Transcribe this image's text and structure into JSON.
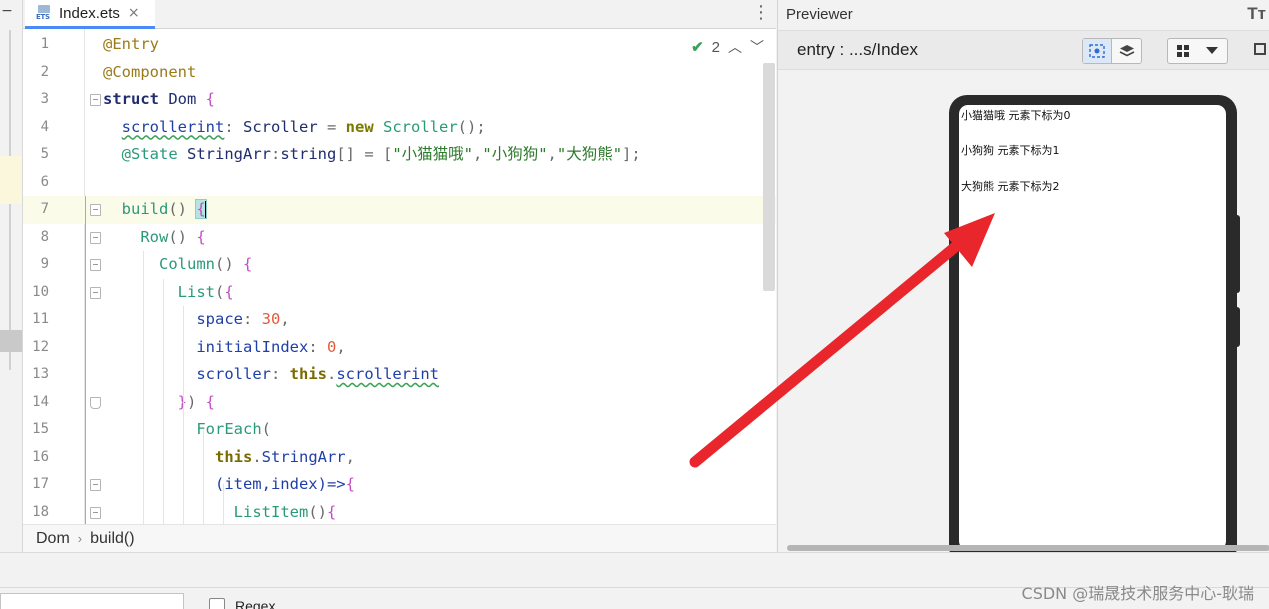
{
  "tab": {
    "label": "Index.ets",
    "icon_text": "ETS",
    "close": "×"
  },
  "editor": {
    "inspection_count": "2",
    "lines": [
      {
        "n": "1",
        "segments": [
          {
            "t": "@Entry",
            "c": "k-anno"
          }
        ]
      },
      {
        "n": "2",
        "segments": [
          {
            "t": "@Component",
            "c": "k-anno"
          }
        ]
      },
      {
        "n": "3",
        "segments": [
          {
            "t": "struct",
            "c": "k-kw"
          },
          {
            "t": " Dom ",
            "c": "k-id"
          },
          {
            "t": "{",
            "c": "k-br"
          }
        ]
      },
      {
        "n": "4",
        "segments": [
          {
            "t": "  "
          },
          {
            "t": "scrollerint",
            "c": "k-prop squig"
          },
          {
            "t": ": ",
            "c": "k-pun"
          },
          {
            "t": "Scroller",
            "c": "k-id"
          },
          {
            "t": " = ",
            "c": "k-pun"
          },
          {
            "t": "new",
            "c": "k-kw2"
          },
          {
            "t": " "
          },
          {
            "t": "Scroller",
            "c": "k-fn"
          },
          {
            "t": "();",
            "c": "k-pun"
          }
        ]
      },
      {
        "n": "5",
        "segments": [
          {
            "t": "  "
          },
          {
            "t": "@State",
            "c": "k-fn"
          },
          {
            "t": " StringArr",
            "c": "k-id"
          },
          {
            "t": ":",
            "c": "k-pun"
          },
          {
            "t": "string",
            "c": "k-id"
          },
          {
            "t": "[] = [",
            "c": "k-pun"
          },
          {
            "t": "\"小猫猫哦\"",
            "c": "k-str"
          },
          {
            "t": ",",
            "c": "k-pun"
          },
          {
            "t": "\"小狗狗\"",
            "c": "k-str"
          },
          {
            "t": ",",
            "c": "k-pun"
          },
          {
            "t": "\"大狗熊\"",
            "c": "k-str"
          },
          {
            "t": "];",
            "c": "k-pun"
          }
        ]
      },
      {
        "n": "6",
        "segments": []
      },
      {
        "n": "7",
        "segments": [
          {
            "t": "  "
          },
          {
            "t": "build",
            "c": "k-fn"
          },
          {
            "t": "() ",
            "c": "k-pun"
          },
          {
            "t": "{",
            "c": "k-br cursor-brace"
          }
        ]
      },
      {
        "n": "8",
        "segments": [
          {
            "t": "    "
          },
          {
            "t": "Row",
            "c": "k-fn"
          },
          {
            "t": "() ",
            "c": "k-pun"
          },
          {
            "t": "{",
            "c": "k-br"
          }
        ]
      },
      {
        "n": "9",
        "segments": [
          {
            "t": "      "
          },
          {
            "t": "Column",
            "c": "k-fn"
          },
          {
            "t": "() ",
            "c": "k-pun"
          },
          {
            "t": "{",
            "c": "k-br"
          }
        ]
      },
      {
        "n": "10",
        "segments": [
          {
            "t": "        "
          },
          {
            "t": "List",
            "c": "k-fn"
          },
          {
            "t": "(",
            "c": "k-pun"
          },
          {
            "t": "{",
            "c": "k-br"
          }
        ]
      },
      {
        "n": "11",
        "segments": [
          {
            "t": "          "
          },
          {
            "t": "space",
            "c": "k-prop"
          },
          {
            "t": ": ",
            "c": "k-pun"
          },
          {
            "t": "30",
            "c": "k-num"
          },
          {
            "t": ",",
            "c": "k-pun"
          }
        ]
      },
      {
        "n": "12",
        "segments": [
          {
            "t": "          "
          },
          {
            "t": "initialIndex",
            "c": "k-prop"
          },
          {
            "t": ": ",
            "c": "k-pun"
          },
          {
            "t": "0",
            "c": "k-num"
          },
          {
            "t": ",",
            "c": "k-pun"
          }
        ]
      },
      {
        "n": "13",
        "segments": [
          {
            "t": "          "
          },
          {
            "t": "scroller",
            "c": "k-prop"
          },
          {
            "t": ": ",
            "c": "k-pun"
          },
          {
            "t": "this",
            "c": "k-th"
          },
          {
            "t": ".",
            "c": "k-pun"
          },
          {
            "t": "scrollerint",
            "c": "k-prop squig"
          }
        ]
      },
      {
        "n": "14",
        "segments": [
          {
            "t": "        "
          },
          {
            "t": "}",
            "c": "k-br"
          },
          {
            "t": ") ",
            "c": "k-pun"
          },
          {
            "t": "{",
            "c": "k-br"
          }
        ]
      },
      {
        "n": "15",
        "segments": [
          {
            "t": "          "
          },
          {
            "t": "ForEach",
            "c": "k-fn"
          },
          {
            "t": "(",
            "c": "k-pun"
          }
        ]
      },
      {
        "n": "16",
        "segments": [
          {
            "t": "            "
          },
          {
            "t": "this",
            "c": "k-th"
          },
          {
            "t": ".",
            "c": "k-pun"
          },
          {
            "t": "StringArr",
            "c": "k-prop"
          },
          {
            "t": ",",
            "c": "k-pun"
          }
        ]
      },
      {
        "n": "17",
        "segments": [
          {
            "t": "            "
          },
          {
            "t": "(item,index)=>",
            "c": "k-prop"
          },
          {
            "t": "{",
            "c": "k-br"
          }
        ]
      },
      {
        "n": "18",
        "segments": [
          {
            "t": "              "
          },
          {
            "t": "ListItem",
            "c": "k-fn"
          },
          {
            "t": "()",
            "c": "k-pun"
          },
          {
            "t": "{",
            "c": "k-br"
          }
        ]
      }
    ]
  },
  "breadcrumb": {
    "items": [
      "Dom",
      "build()"
    ],
    "separator": "›"
  },
  "previewer": {
    "title": "Previewer",
    "title_icon": "Tт",
    "path": "entry : ...s/Index",
    "list_items": [
      "小猫猫哦 元素下标为0",
      "小狗狗 元素下标为1",
      "大狗熊 元素下标为2"
    ]
  },
  "bottom": {
    "regex_label": "Regex"
  },
  "watermark": "CSDN @瑞晟技术服务中心-耿瑞",
  "colors": {
    "arrow": "#e8262b",
    "accent": "#4a8bf6"
  }
}
